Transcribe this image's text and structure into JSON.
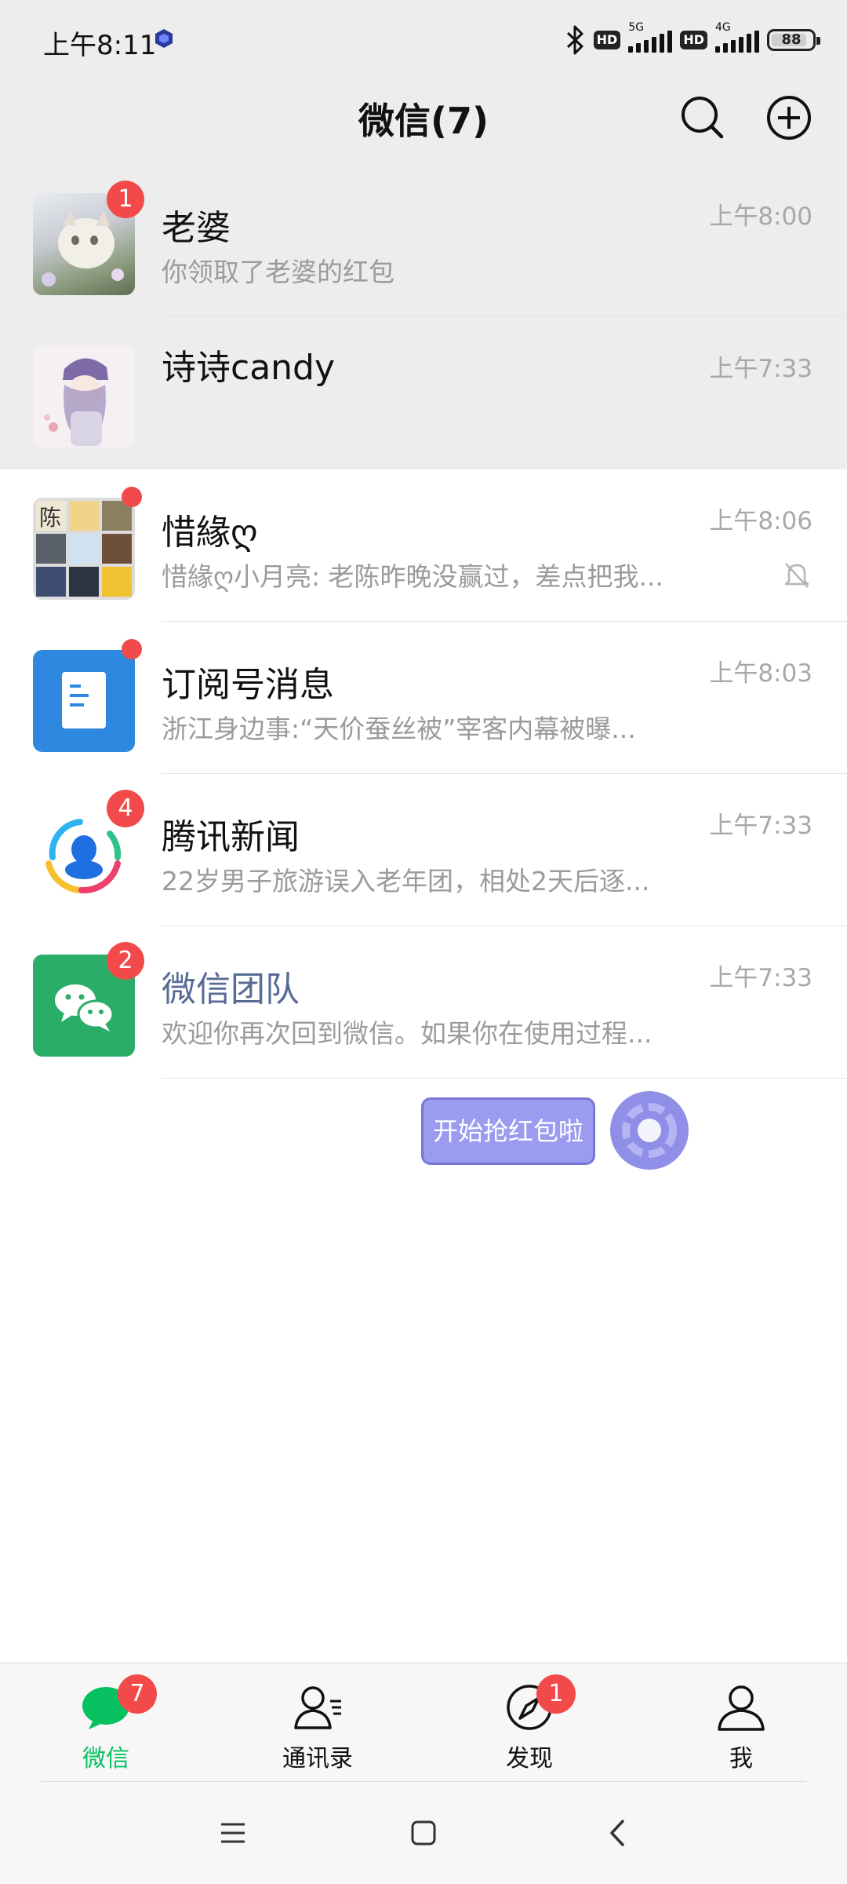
{
  "status_bar": {
    "time": "上午8:11",
    "hd1": "HD",
    "net1": "5G",
    "hd2": "HD",
    "net2": "4G",
    "battery": "88",
    "battery_level": 0.88
  },
  "header": {
    "title": "微信(7)"
  },
  "chats": [
    {
      "name": "老婆",
      "message": "你领取了老婆的红包",
      "time": "上午8:00",
      "badge": "1",
      "pinned": true
    },
    {
      "name": "诗诗candy",
      "message": "",
      "time": "上午7:33",
      "pinned": true
    },
    {
      "name": "惜緣ღ",
      "message": "惜緣ღ小月亮: 老陈昨晚没赢过，差点把我...",
      "time": "上午8:06",
      "dot": true,
      "muted": true,
      "avatar_char": "陈"
    },
    {
      "name": "订阅号消息",
      "message": "浙江身边事:“天价蚕丝被”宰客内幕被曝...",
      "time": "上午8:03",
      "dot": true
    },
    {
      "name": "腾讯新闻",
      "message": "22岁男子旅游误入老年团，相处2天后逐...",
      "time": "上午7:33",
      "badge": "4"
    },
    {
      "name": "微信团队",
      "message": "欢迎你再次回到微信。如果你在使用过程...",
      "time": "上午7:33",
      "badge": "2"
    }
  ],
  "floating": {
    "label": "开始抢红包啦"
  },
  "tabbar": {
    "items": [
      {
        "label": "微信",
        "badge": "7",
        "active": true
      },
      {
        "label": "通讯录"
      },
      {
        "label": "发现",
        "badge": "1"
      },
      {
        "label": "我"
      }
    ]
  },
  "colors": {
    "accent": "#07c160",
    "badge": "#f24a4a",
    "header_bg": "#ededed",
    "link_name": "#576b95"
  }
}
